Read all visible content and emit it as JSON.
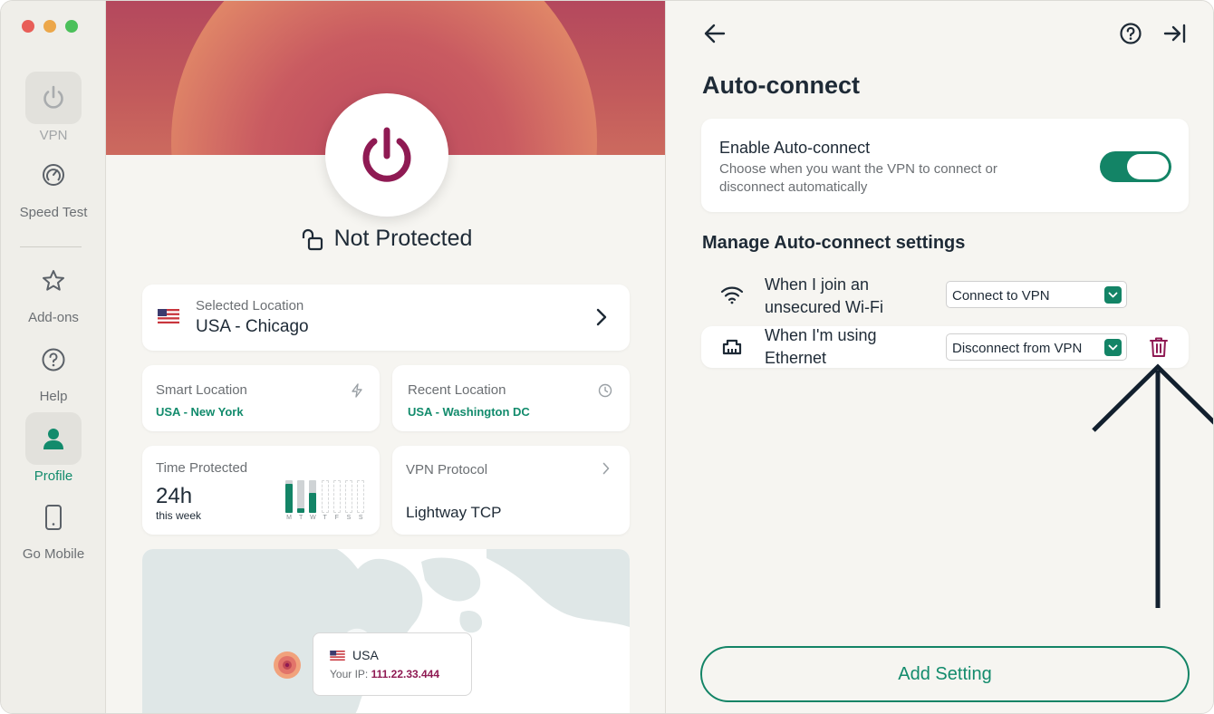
{
  "sidebar": {
    "items": [
      {
        "label": "VPN"
      },
      {
        "label": "Speed Test"
      },
      {
        "label": "Add-ons"
      },
      {
        "label": "Help"
      },
      {
        "label": "Profile"
      },
      {
        "label": "Go Mobile"
      }
    ]
  },
  "main": {
    "status": "Not Protected",
    "selected_location": {
      "label": "Selected Location",
      "value": "USA - Chicago"
    },
    "smart_location": {
      "label": "Smart Location",
      "value": "USA - New York"
    },
    "recent_location": {
      "label": "Recent Location",
      "value": "USA - Washington DC"
    },
    "time_protected": {
      "label": "Time Protected",
      "value": "24h",
      "sub": "this week",
      "days": [
        "M",
        "T",
        "W",
        "T",
        "F",
        "S",
        "S"
      ],
      "levels": [
        0.9,
        0.15,
        0.6,
        0,
        0,
        0,
        0
      ]
    },
    "protocol": {
      "label": "VPN Protocol",
      "value": "Lightway TCP"
    },
    "map_tooltip": {
      "country": "USA",
      "ip_label": "Your IP:",
      "ip": "111.22.33.444"
    }
  },
  "panel": {
    "title": "Auto-connect",
    "enable": {
      "title": "Enable Auto-connect",
      "desc_line1": "Choose when you want the VPN to connect or",
      "desc_line2": "disconnect automatically",
      "on": true
    },
    "section_title": "Manage Auto-connect settings",
    "rules": [
      {
        "line1": "When I join an",
        "line2": "unsecured Wi-Fi",
        "action": "Connect to VPN",
        "icon": "wifi-icon"
      },
      {
        "line1": "When I'm using",
        "line2": "Ethernet",
        "action": "Disconnect from VPN",
        "icon": "ethernet-icon"
      }
    ],
    "add_button": "Add Setting"
  },
  "colors": {
    "accent": "#138466",
    "brand": "#8f1a53",
    "hero": "#c25a5c",
    "arrow": "#12202e"
  }
}
